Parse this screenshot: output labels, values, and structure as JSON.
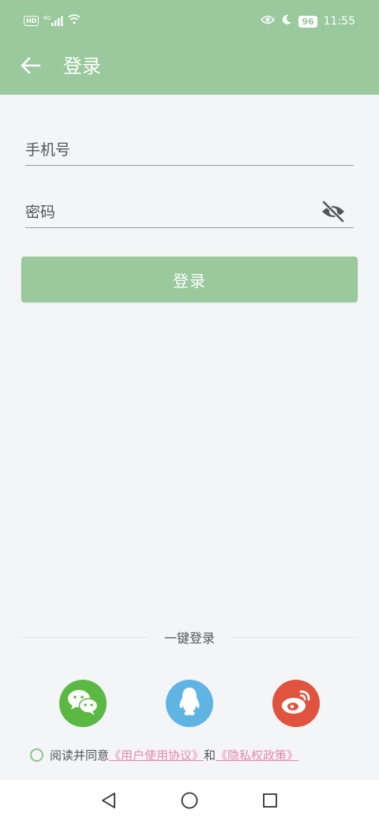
{
  "status_bar": {
    "hd": "HD",
    "network": "4G",
    "battery": "96",
    "time": "11:55",
    "icons": [
      "hd-icon",
      "signal-icon",
      "wifi-icon",
      "eye-icon",
      "moon-icon",
      "battery-icon"
    ]
  },
  "app_bar": {
    "title": "登录",
    "back_icon": "arrow-left-icon"
  },
  "form": {
    "phone_placeholder": "手机号",
    "phone_value": "",
    "password_placeholder": "密码",
    "password_value": "",
    "visibility_icon": "eye-off-icon",
    "login_button": "登录"
  },
  "quick_login": {
    "label": "一键登录",
    "providers": [
      {
        "name": "wechat",
        "icon": "wechat-icon",
        "color": "#5bb943"
      },
      {
        "name": "qq",
        "icon": "qq-icon",
        "color": "#5fb4e4"
      },
      {
        "name": "weibo",
        "icon": "weibo-icon",
        "color": "#e0533f"
      }
    ]
  },
  "agreement": {
    "prefix": "阅读并同意",
    "user_agreement": "《用户使用协议》",
    "conjunction": "和",
    "privacy_policy": "《隐私权政策》"
  },
  "colors": {
    "primary": "#99c99c",
    "link": "#e68aa8",
    "background": "#f4f5f7"
  }
}
